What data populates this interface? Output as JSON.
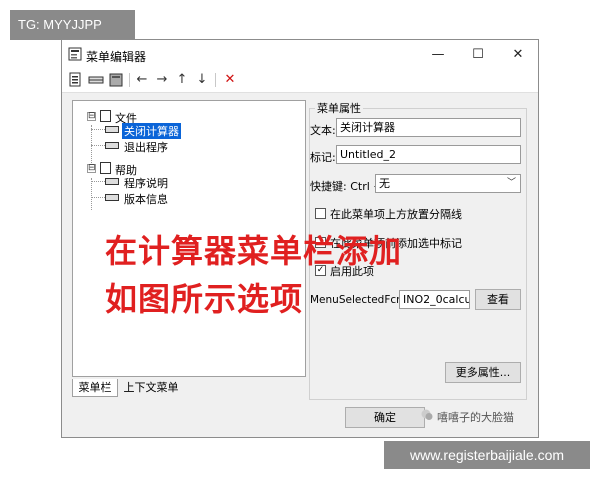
{
  "top_tag": "TG: MYYJJPP",
  "window": {
    "title": "菜单编辑器",
    "controls": {
      "minimize": "—",
      "maximize": "☐",
      "close": "✕"
    }
  },
  "toolbar": {
    "icons": [
      "new-item-icon",
      "insert-separator-icon",
      "delete-group-icon",
      "move-left-icon",
      "move-right-icon",
      "move-up-icon",
      "move-down-icon",
      "delete-icon"
    ],
    "glyphs": {
      "left": "←",
      "right": "→",
      "up": "↑",
      "down": "↓",
      "delete": "✕"
    }
  },
  "tree": {
    "menus": [
      {
        "label": "文件",
        "items": [
          "关闭计算器",
          "退出程序"
        ]
      },
      {
        "label": "帮助",
        "items": [
          "程序说明",
          "版本信息"
        ]
      }
    ],
    "selected": "关闭计算器",
    "expander": "⊟"
  },
  "tabs": [
    "菜单栏",
    "上下文菜单"
  ],
  "properties": {
    "group_title": "菜单属性",
    "text_label": "文本:",
    "text_value": "关闭计算器",
    "tag_label": "标记:",
    "tag_value": "Untitled_2",
    "shortcut_label": "快捷键: Ctrl +",
    "shortcut_value": "无",
    "separator_label": "在此菜单项上方放置分隔线",
    "check_label": "在此菜单项前添加选中标记",
    "enable_label": "启用此项",
    "callback_label": "MenuSelectedFcn:",
    "callback_value": "INO2_0calcu",
    "browse_button": "查看",
    "more_button": "更多属性..."
  },
  "ok_button": "确定",
  "overlay_text": [
    "在计算器菜单栏添加",
    "如图所示选项"
  ],
  "wechat_source": "嘻嘻子的大脸猫",
  "bottom_watermark": "www.registerbaijiale.com",
  "colors": {
    "overlay": "#e02020",
    "selection": "#0a64d8",
    "watermark_bg": "#8a8a8a"
  }
}
